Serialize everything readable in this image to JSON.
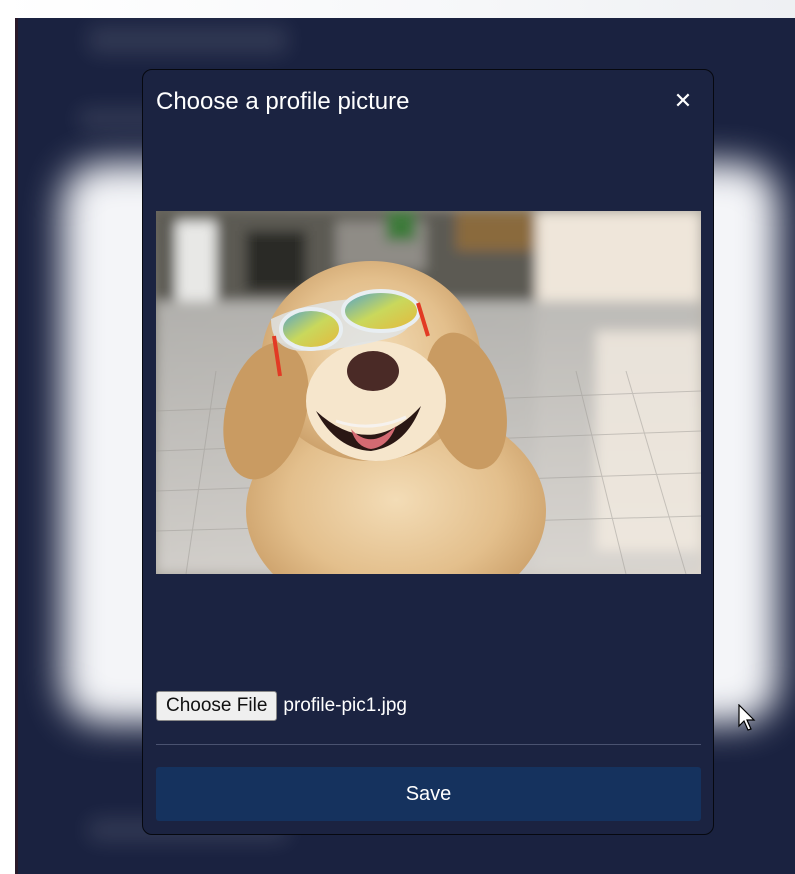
{
  "modal": {
    "title": "Choose a profile picture",
    "close_icon": "close-icon",
    "close_glyph": "✕",
    "photo_description": "preview-image",
    "file_input": {
      "button_label": "Choose File",
      "file_name": "profile-pic1.jpg"
    },
    "save_label": "Save"
  },
  "colors": {
    "backdrop": "#1a2240",
    "modal_bg": "#1b2341",
    "save_bg": "#15325e",
    "text": "#ffffff"
  }
}
